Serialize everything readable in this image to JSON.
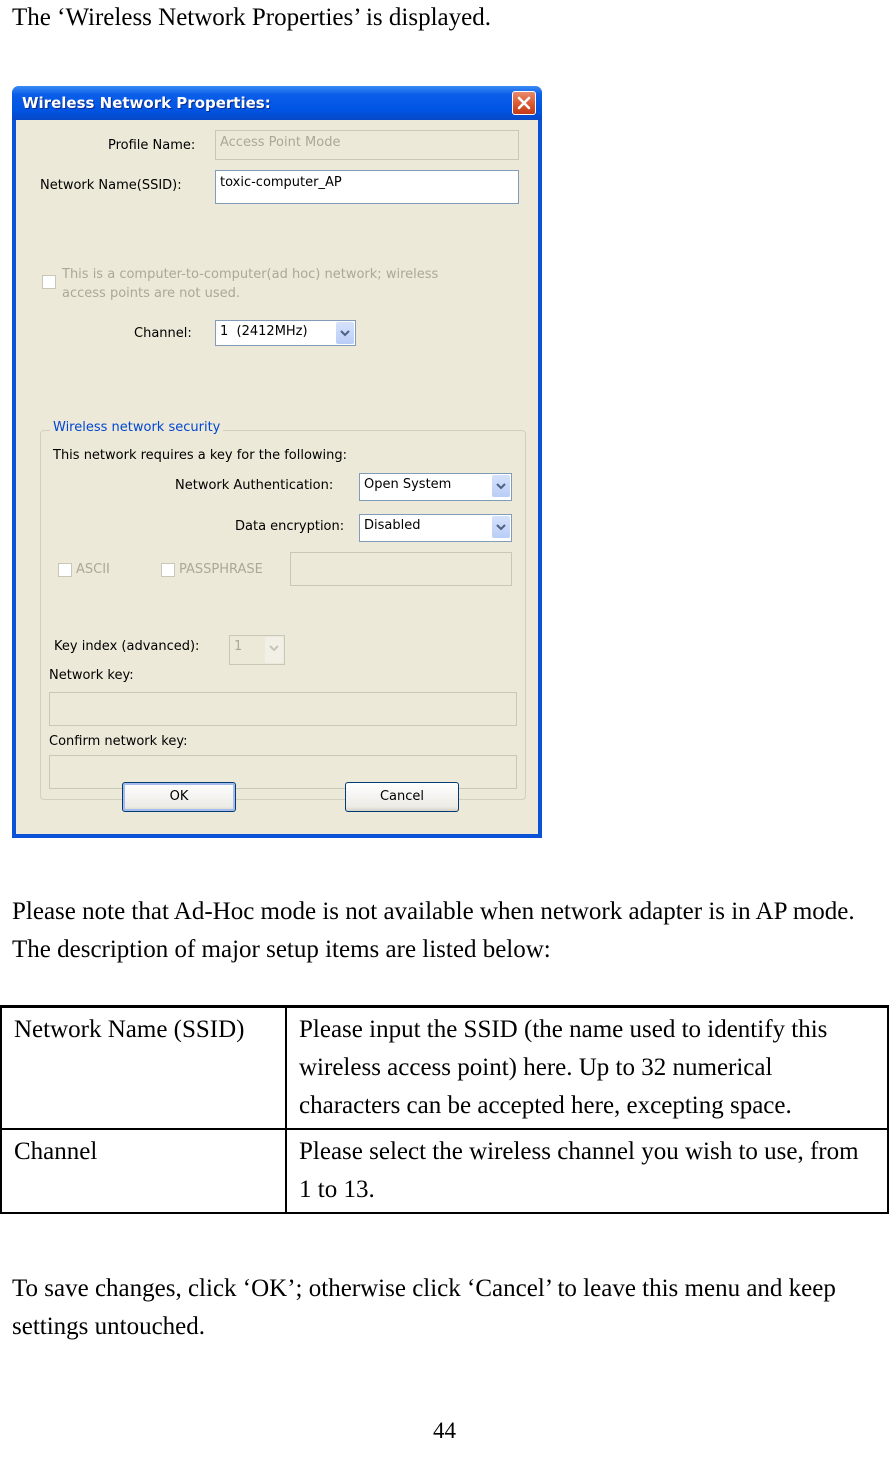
{
  "intro_text": "The ‘Wireless Network Properties’ is displayed.",
  "dialog": {
    "title": "Wireless Network Properties:",
    "close_icon": "close-icon",
    "profile_name_label": "Profile Name:",
    "profile_name_value": "Access Point Mode",
    "ssid_label": "Network Name(SSID):",
    "ssid_value": "toxic-computer_AP",
    "adhoc_checkbox_label_line1": "This is a computer-to-computer(ad hoc) network; wireless",
    "adhoc_checkbox_label_line2": "access points are not used.",
    "adhoc_checked": false,
    "channel_label": "Channel:",
    "channel_value": "1  (2412MHz)",
    "security_group_label": "Wireless network security",
    "security_intro": "This network requires a key for the following:",
    "auth_label": "Network Authentication:",
    "auth_value": "Open System",
    "encryption_label": "Data encryption:",
    "encryption_value": "Disabled",
    "ascii_label": "ASCII",
    "passphrase_label": "PASSPHRASE",
    "passphrase_value": "",
    "key_index_label": "Key index (advanced):",
    "key_index_value": "1",
    "network_key_label": "Network key:",
    "network_key_value": "",
    "confirm_key_label": "Confirm network key:",
    "confirm_key_value": "",
    "ok_label": "OK",
    "cancel_label": "Cancel"
  },
  "note_text": "Please note that Ad-Hoc mode is not available when network adapter is in AP mode. The description of major setup items are listed below:",
  "table": {
    "rows": [
      {
        "item": "Network Name (SSID)",
        "description": "Please input the SSID (the name used to identify this wireless access point) here. Up to 32 numerical characters can be accepted here, excepting space."
      },
      {
        "item": "Channel",
        "description": "Please select the wireless channel you wish to use, from 1 to 13."
      }
    ]
  },
  "save_text": "To save changes, click ‘OK’; otherwise click ‘Cancel’ to leave this menu and keep settings untouched.",
  "page_number": "44"
}
